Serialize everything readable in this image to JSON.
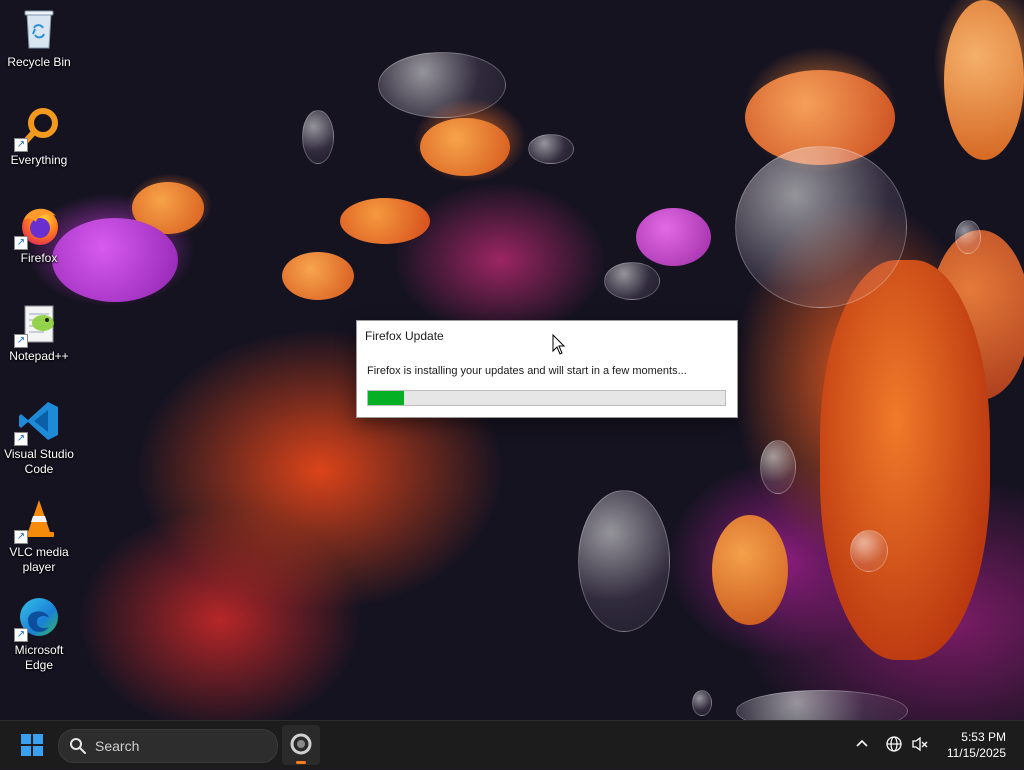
{
  "desktop_icons": [
    {
      "id": "recycle-bin",
      "label": "Recycle Bin"
    },
    {
      "id": "everything",
      "label": "Everything"
    },
    {
      "id": "firefox",
      "label": "Firefox"
    },
    {
      "id": "notepadpp",
      "label": "Notepad++"
    },
    {
      "id": "vscode",
      "label": "Visual Studio Code"
    },
    {
      "id": "vlc",
      "label": "VLC media player"
    },
    {
      "id": "edge",
      "label": "Microsoft Edge"
    }
  ],
  "dialog": {
    "title": "Firefox Update",
    "message": "Firefox is installing your updates and will start in a few moments...",
    "progress_fraction": 0.1
  },
  "taskbar": {
    "search_placeholder": "Search",
    "clock_time": "5:53 PM",
    "clock_date": "11/15/2025"
  },
  "colors": {
    "progress_fill": "#06b025",
    "taskbar_bg": "#1c1c1c",
    "accent_indicator": "#ff7a1a"
  }
}
